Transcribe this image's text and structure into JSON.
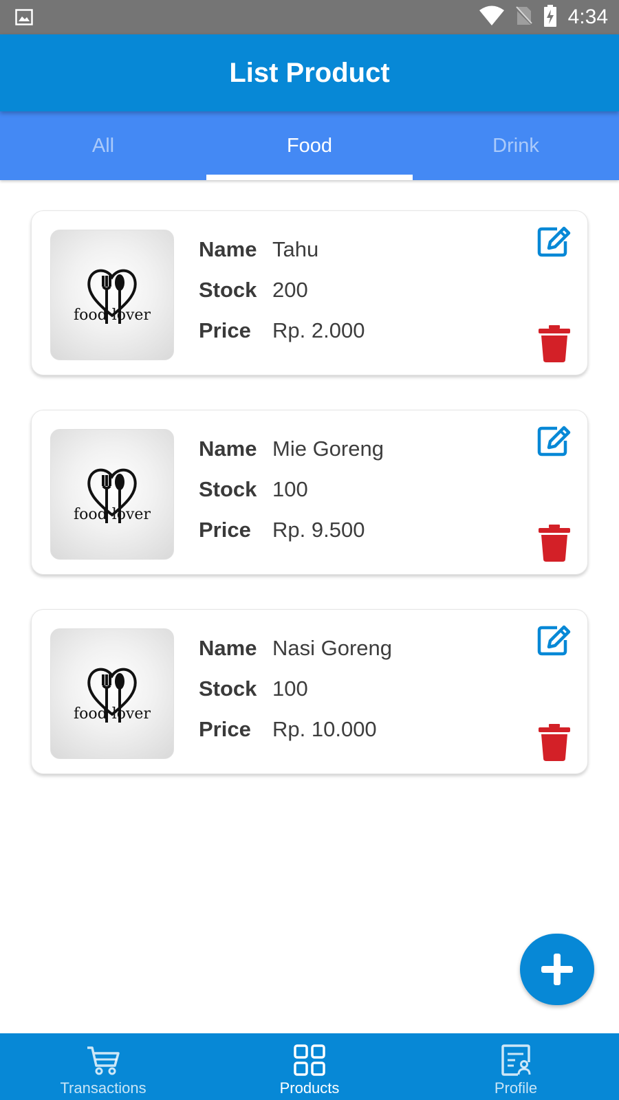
{
  "status_bar": {
    "time": "4:34"
  },
  "app_bar": {
    "title": "List Product"
  },
  "tabs": [
    {
      "label": "All",
      "active": false
    },
    {
      "label": "Food",
      "active": true
    },
    {
      "label": "Drink",
      "active": false
    }
  ],
  "field_labels": {
    "name": "Name",
    "stock": "Stock",
    "price": "Price"
  },
  "products": [
    {
      "name": "Tahu",
      "stock": "200",
      "price": "Rp. 2.000",
      "image_logo": "food lover"
    },
    {
      "name": "Mie Goreng",
      "stock": "100",
      "price": "Rp. 9.500",
      "image_logo": "food lover"
    },
    {
      "name": "Nasi Goreng",
      "stock": "100",
      "price": "Rp. 10.000",
      "image_logo": "food lover"
    }
  ],
  "bottom_nav": [
    {
      "label": "Transactions",
      "icon": "cart-icon",
      "active": false
    },
    {
      "label": "Products",
      "icon": "grid-icon",
      "active": true
    },
    {
      "label": "Profile",
      "icon": "profile-icon",
      "active": false
    }
  ],
  "colors": {
    "primary": "#0788d6",
    "tab_bar": "#4489f4",
    "status_bar": "#757575",
    "edit_icon": "#0788d6",
    "delete_icon": "#d32027"
  }
}
